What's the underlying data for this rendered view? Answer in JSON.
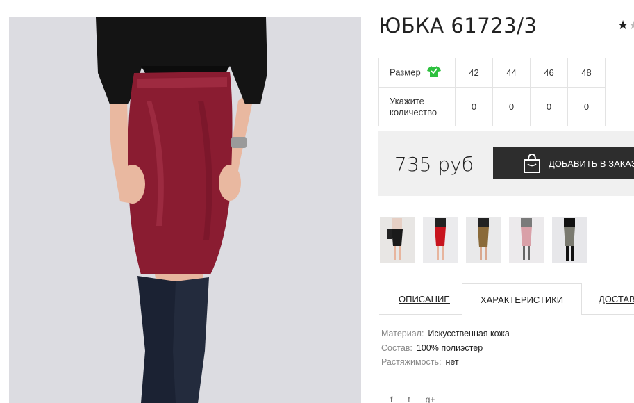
{
  "product": {
    "title": "ЮБКА 61723/3",
    "rating_icon": "star-icon"
  },
  "sizes": {
    "size_label": "Размер",
    "qty_label": "Укажите количество",
    "values": [
      "42",
      "44",
      "46",
      "48"
    ],
    "quantities": [
      "0",
      "0",
      "0",
      "0"
    ],
    "size_icon": "tshirt-icon",
    "size_icon_color": "#2ec13f"
  },
  "purchase": {
    "price": "735 руб",
    "order_button": "ДОБАВИТЬ В ЗАКАЗ",
    "order_icon": "shopping-bag-icon"
  },
  "tabs": {
    "description": "ОПИСАНИЕ",
    "characteristics": "ХАРАКТЕРИСТИКИ",
    "delivery": "ДОСТАВКА"
  },
  "characteristics": [
    {
      "key": "Материал:",
      "value": "Искусственная кожа"
    },
    {
      "key": "Состав:",
      "value": "100% полиэстер"
    },
    {
      "key": "Растяжимость:",
      "value": "нет"
    }
  ],
  "social": [
    "f",
    "t",
    "g+"
  ],
  "colors": {
    "skirt_main": "#8a1c31",
    "thumb_colors": [
      "#1a1a1a",
      "#c8141e",
      "#8a6a3a",
      "#d9a0a8",
      "#7a7a70"
    ]
  }
}
